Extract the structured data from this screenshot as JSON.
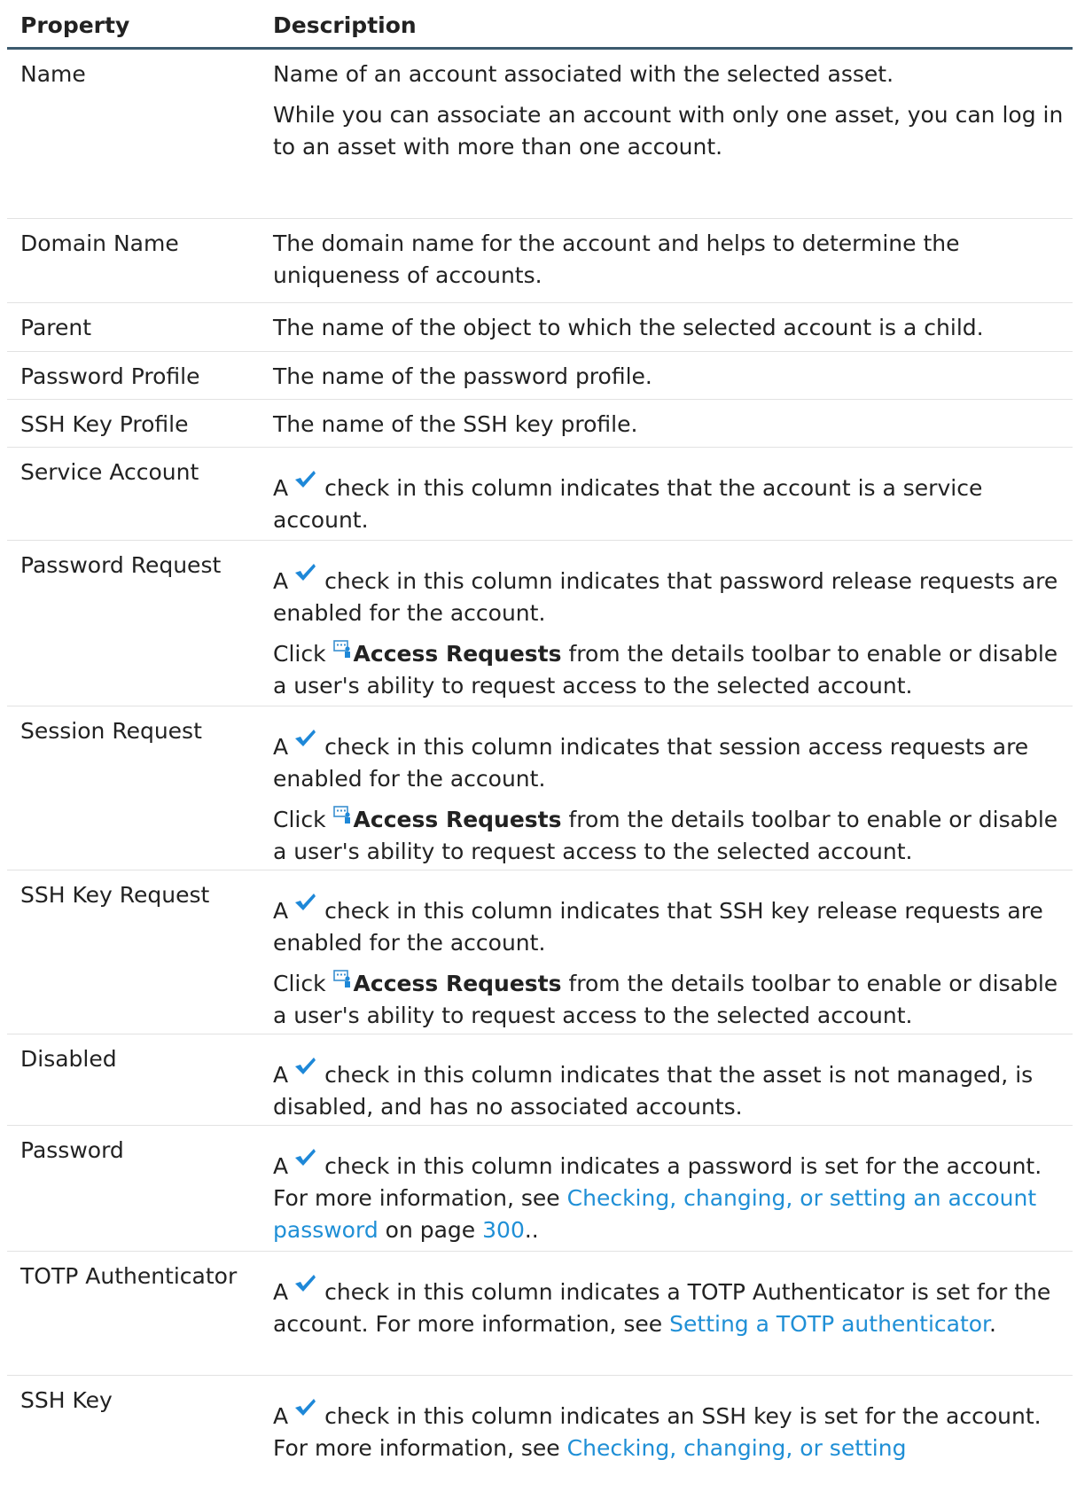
{
  "header": {
    "property": "Property",
    "description": "Description"
  },
  "check_prefix": "A",
  "click_word": "Click",
  "access_requests_label": "Access Requests",
  "access_requests_tail": "from the details toolbar to enable or disable a user's ability to request access to the selected account.",
  "rows": [
    {
      "name": "Name",
      "p1": "Name of an account associated with the selected asset.",
      "p2": "While you can associate an account with only one asset, you can log in to an asset with more than one account."
    },
    {
      "name": "Domain Name",
      "p1": "The domain name for the account and helps to determine the uniqueness of accounts."
    },
    {
      "name": "Parent",
      "p1": "The name of the object to which the selected account is a child."
    },
    {
      "name": "Password Profile",
      "p1": "The name of the password profile."
    },
    {
      "name": "SSH Key Profile",
      "p1": "The name of the SSH key profile."
    },
    {
      "name": "Service Account",
      "check_text": "check in this column indicates that the account is a service account."
    },
    {
      "name": "Password Request",
      "check_text": "check in this column indicates that password release requests are enabled for the account."
    },
    {
      "name": "Session Request",
      "check_text": "check in this column indicates that session access requests are enabled for the account."
    },
    {
      "name": "SSH Key Request",
      "check_text": "check in this column indicates that SSH key release requests are enabled for the account."
    },
    {
      "name": "Disabled",
      "check_text": "check in this column indicates that the asset is not managed, is disabled, and has no associated accounts."
    },
    {
      "name": "Password",
      "check_text": "check in this column indicates a password is set for the account. For more information, see",
      "link": "Checking, changing, or setting an account password",
      "on_page": "on page",
      "page": "300",
      "tail": ".."
    },
    {
      "name": "TOTP Authenticator",
      "check_text": "check in this column indicates a TOTP Authenticator is set for the account. For more information, see",
      "link": "Setting a TOTP authenticator",
      "tail": "."
    },
    {
      "name": "SSH Key",
      "check_text": "check in this column indicates an SSH key is set for the account. For more information, see",
      "link": "Checking, changing, or setting"
    }
  ],
  "colors": {
    "header_rule": "#3c5a6e",
    "link": "#1f8fd6",
    "check": "#1e88d8",
    "row_divider": "#e2e2e2"
  }
}
